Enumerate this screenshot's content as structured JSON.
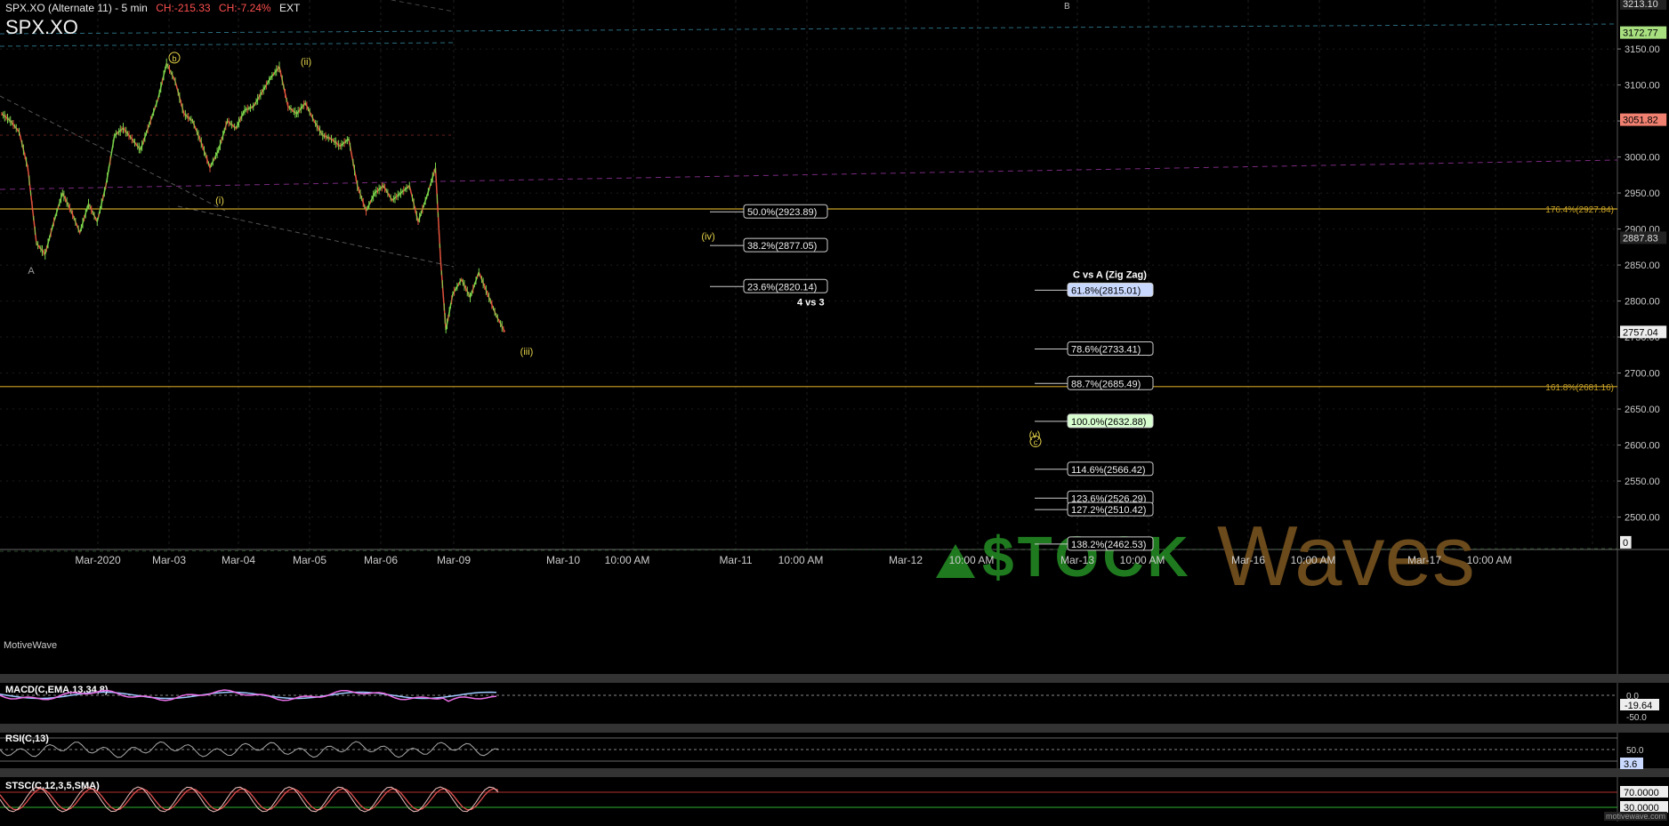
{
  "header": {
    "symbol_line": "SPX.XO (Alternate 11) - 5 min",
    "change_points": "CH:-215.33",
    "change_percent": "CH:-7.24%",
    "session": "EXT",
    "title": "SPX.XO",
    "brand": "MotiveWave",
    "watermark": "motivewave.com"
  },
  "colors": {
    "background": "#000000",
    "candle_up": "#7bd34a",
    "candle_down": "#e0533d",
    "fib_line": "#c9a227",
    "wave_label": "#e6d44a",
    "macd": "#e96fe6",
    "macd_signal": "#9ec8ff",
    "price_tag_red": "#f08070",
    "price_tag_green": "#a8e080",
    "logo_green": "#1f7a1f",
    "logo_brown": "#6b4a1c"
  },
  "chart_data": [
    {
      "type": "line",
      "name": "price-panel",
      "x_axis_labels": [
        "Mar-2020",
        "Mar-03",
        "Mar-04",
        "Mar-05",
        "Mar-06",
        "Mar-09",
        "Mar-10",
        "10:00 AM",
        "Mar-11",
        "10:00 AM",
        "Mar-12",
        "10:00 AM",
        "Mar-13",
        "10:00 AM",
        "Mar-16",
        "10:00 AM",
        "Mar-17",
        "10:00 AM"
      ],
      "y_ticks": [
        3150,
        3100,
        3050,
        3000,
        2950,
        2900,
        2850,
        2800,
        2750,
        2700,
        2650,
        2600,
        2550,
        2500
      ],
      "y_ticks_labels": [
        "3150.00",
        "3100.00",
        "3050.00",
        "3000.00",
        "2950.00",
        "2900.00",
        "2850.00",
        "2800.00",
        "2750.00",
        "2700.00",
        "2650.00",
        "2600.00",
        "2550.00",
        "2500.00"
      ],
      "ylim": [
        2455,
        3218
      ],
      "price_path": [
        {
          "x": 0,
          "y": 3060
        },
        {
          "x": 0.5,
          "y": 3050
        },
        {
          "x": 1,
          "y": 3035
        },
        {
          "x": 1.5,
          "y": 2985
        },
        {
          "x": 2,
          "y": 2880
        },
        {
          "x": 2.5,
          "y": 2865
        },
        {
          "x": 3,
          "y": 2910
        },
        {
          "x": 3.5,
          "y": 2950
        },
        {
          "x": 4,
          "y": 2925
        },
        {
          "x": 4.5,
          "y": 2895
        },
        {
          "x": 5,
          "y": 2935
        },
        {
          "x": 5.5,
          "y": 2910
        },
        {
          "x": 6,
          "y": 2960
        },
        {
          "x": 6.5,
          "y": 3030
        },
        {
          "x": 7,
          "y": 3040
        },
        {
          "x": 7.5,
          "y": 3025
        },
        {
          "x": 8,
          "y": 3010
        },
        {
          "x": 8.5,
          "y": 3045
        },
        {
          "x": 9,
          "y": 3080
        },
        {
          "x": 9.5,
          "y": 3130
        },
        {
          "x": 10,
          "y": 3105
        },
        {
          "x": 10.5,
          "y": 3060
        },
        {
          "x": 11,
          "y": 3050
        },
        {
          "x": 11.5,
          "y": 3020
        },
        {
          "x": 12,
          "y": 2985
        },
        {
          "x": 12.5,
          "y": 3010
        },
        {
          "x": 13,
          "y": 3050
        },
        {
          "x": 13.5,
          "y": 3040
        },
        {
          "x": 14,
          "y": 3065
        },
        {
          "x": 14.5,
          "y": 3070
        },
        {
          "x": 15,
          "y": 3090
        },
        {
          "x": 15.5,
          "y": 3110
        },
        {
          "x": 16,
          "y": 3125
        },
        {
          "x": 16.5,
          "y": 3070
        },
        {
          "x": 17,
          "y": 3060
        },
        {
          "x": 17.5,
          "y": 3075
        },
        {
          "x": 18,
          "y": 3050
        },
        {
          "x": 18.5,
          "y": 3030
        },
        {
          "x": 19,
          "y": 3025
        },
        {
          "x": 19.5,
          "y": 3015
        },
        {
          "x": 20,
          "y": 3025
        },
        {
          "x": 20.5,
          "y": 2960
        },
        {
          "x": 21,
          "y": 2925
        },
        {
          "x": 21.5,
          "y": 2950
        },
        {
          "x": 22,
          "y": 2960
        },
        {
          "x": 22.5,
          "y": 2940
        },
        {
          "x": 23,
          "y": 2950
        },
        {
          "x": 23.5,
          "y": 2960
        },
        {
          "x": 24,
          "y": 2910
        },
        {
          "x": 24.5,
          "y": 2945
        },
        {
          "x": 25,
          "y": 2985
        },
        {
          "x": 25.3,
          "y": 2855
        },
        {
          "x": 25.6,
          "y": 2760
        },
        {
          "x": 26,
          "y": 2810
        },
        {
          "x": 26.5,
          "y": 2830
        },
        {
          "x": 27,
          "y": 2805
        },
        {
          "x": 27.5,
          "y": 2840
        },
        {
          "x": 28,
          "y": 2810
        },
        {
          "x": 28.5,
          "y": 2780
        },
        {
          "x": 29,
          "y": 2757
        }
      ],
      "x_day_ticks": [
        {
          "x": 5,
          "label": "Mar-2020"
        },
        {
          "x": 9.5,
          "label": "Mar-03"
        },
        {
          "x": 13.5,
          "label": "Mar-04"
        },
        {
          "x": 17.5,
          "label": "Mar-05"
        },
        {
          "x": 21.5,
          "label": "Mar-06"
        },
        {
          "x": 25.5,
          "label": "Mar-09"
        }
      ],
      "fib_retracements": [
        {
          "label": "50.0%(2923.89)",
          "value": 2923.89
        },
        {
          "label": "38.2%(2877.05)",
          "value": 2877.05
        },
        {
          "label": "23.6%(2820.14)",
          "value": 2820.14
        }
      ],
      "fib_extensions": [
        {
          "label": "61.8%(2815.01)",
          "value": 2815.01,
          "highlight": "blue"
        },
        {
          "label": "78.6%(2733.41)",
          "value": 2733.41
        },
        {
          "label": "88.7%(2685.49)",
          "value": 2685.49
        },
        {
          "label": "100.0%(2632.88)",
          "value": 2632.88,
          "highlight": "green"
        },
        {
          "label": "114.6%(2566.42)",
          "value": 2566.42
        },
        {
          "label": "123.6%(2526.29)",
          "value": 2526.29
        },
        {
          "label": "127.2%(2510.42)",
          "value": 2510.42
        },
        {
          "label": "138.2%(2462.53)",
          "value": 2462.53
        }
      ],
      "horizontal_levels": [
        {
          "label": "176.4%(2927.84)",
          "value": 2927.84
        },
        {
          "label": "161.8%(2681.16)",
          "value": 2681.16
        }
      ],
      "annotations": [
        {
          "text": "4 vs 3"
        },
        {
          "text": "C vs A (Zig Zag)"
        },
        {
          "text": "B"
        }
      ],
      "wave_labels": [
        {
          "text": "A",
          "value": 2850,
          "x": 2
        },
        {
          "text": "b",
          "value": 3133,
          "x": 9.7,
          "circled": true
        },
        {
          "text": "(i)",
          "value": 2980,
          "x": 12.3
        },
        {
          "text": "(ii)",
          "value": 3128,
          "x": 16.5
        },
        {
          "text": "(iii)",
          "value": 2740
        },
        {
          "text": "(iv)",
          "value": 2895
        },
        {
          "text": "(v)",
          "value": 2620
        },
        {
          "text": "c",
          "value": 2600,
          "circled": true
        }
      ],
      "price_tags": [
        {
          "label": "3213.10",
          "value": 3213.1,
          "style": "gray"
        },
        {
          "label": "3172.77",
          "value": 3172.77,
          "style": "green"
        },
        {
          "label": "3051.82",
          "value": 3051.82,
          "style": "red"
        },
        {
          "label": "2887.83",
          "value": 2887.83,
          "style": "gray"
        },
        {
          "label": "2757.04",
          "value": 2757.04,
          "style": "white"
        },
        {
          "label": "0",
          "value": 2465,
          "style": "white"
        }
      ]
    },
    {
      "type": "line",
      "name": "MACD(C,EMA,13,34,8)",
      "title": "MACD(C,EMA,13,34,8)",
      "y_ticks_labels": [
        "0.0",
        "-50.0"
      ],
      "current_value": "-19.64"
    },
    {
      "type": "line",
      "name": "RSI(C,13)",
      "title": "RSI(C,13)",
      "y_ticks_labels": [
        "50.0"
      ],
      "current_value": "3.6"
    },
    {
      "type": "line",
      "name": "STSC(C,12,3,5,SMA)",
      "title": "STSC(C,12,3,5,SMA)",
      "y_ticks_labels": [
        "70.0000",
        "30.0000"
      ]
    }
  ]
}
